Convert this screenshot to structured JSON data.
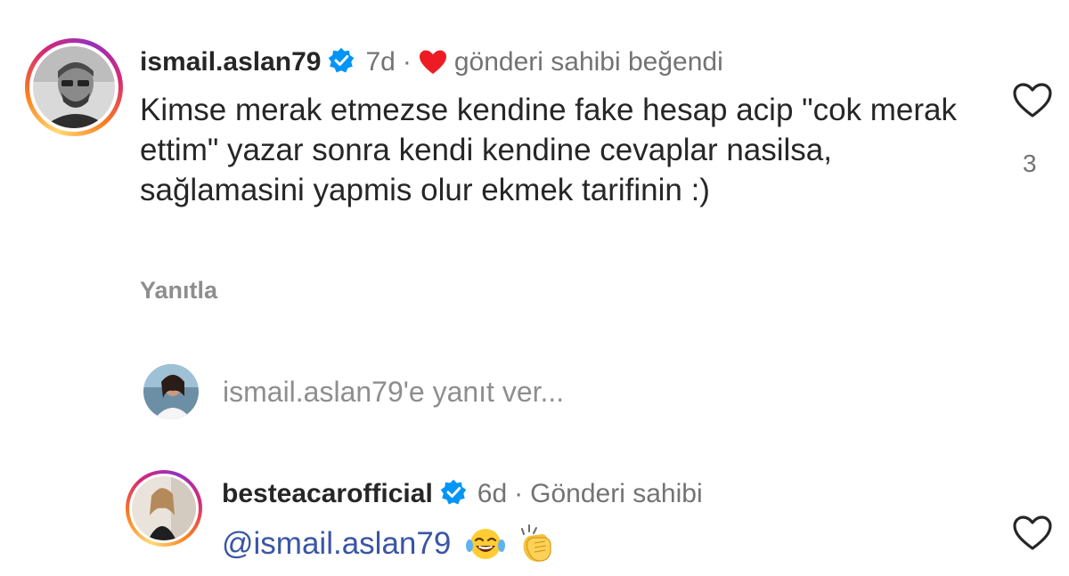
{
  "comment": {
    "username": "ismail.aslan79",
    "time": "7d",
    "separator": "·",
    "liked_label": "gönderi sahibi beğendi",
    "text": "Kimse merak etmezse kendine fake hesap acip \"cok merak ettim\" yazar sonra kendi kendine cevaplar nasilsa, sağlamasini yapmis olur ekmek tarifinin :)",
    "like_count": "3",
    "reply_label": "Yanıtla"
  },
  "reply_box": {
    "placeholder": "ismail.aslan79'e yanıt ver..."
  },
  "reply": {
    "username": "besteacarofficial",
    "time": "6d",
    "separator": "·",
    "role_label": "Gönderi sahibi",
    "mention": "@ismail.aslan79",
    "emojis": [
      "face-with-tears-of-joy",
      "clapping-hands"
    ]
  },
  "colors": {
    "verified": "#0095f6",
    "heart_liked": "#ed1c24",
    "mention": "#3a55a6",
    "muted": "#737373"
  }
}
